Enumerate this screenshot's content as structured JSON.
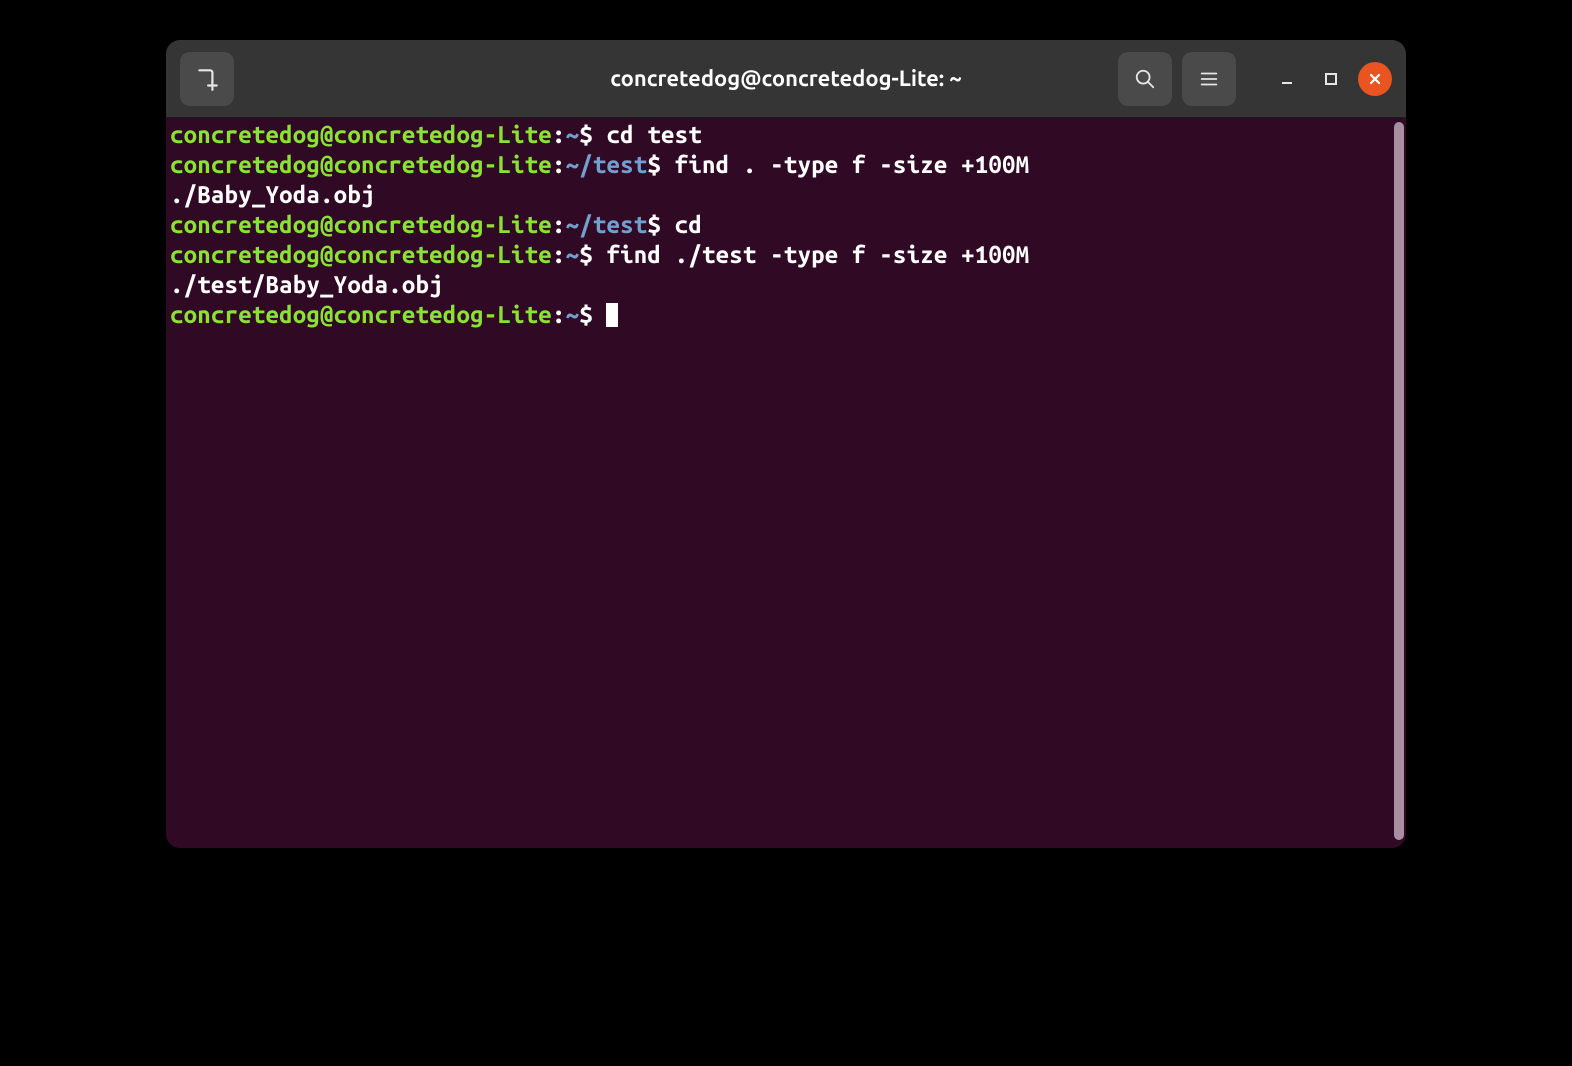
{
  "window": {
    "title": "concretedog@concretedog-Lite: ~"
  },
  "colors": {
    "bg": "#300a24",
    "user": "#8ae234",
    "path": "#729fcf",
    "text": "#ffffff",
    "close": "#e95420",
    "titlebar": "#353535"
  },
  "lines": [
    {
      "type": "prompt",
      "user": "concretedog@concretedog-Lite",
      "sep": ":",
      "path": "~",
      "dollar": "$",
      "cmd": " cd test"
    },
    {
      "type": "prompt",
      "user": "concretedog@concretedog-Lite",
      "sep": ":",
      "path": "~/test",
      "dollar": "$",
      "cmd": " find . -type f -size +100M"
    },
    {
      "type": "output",
      "text": "./Baby_Yoda.obj"
    },
    {
      "type": "prompt",
      "user": "concretedog@concretedog-Lite",
      "sep": ":",
      "path": "~/test",
      "dollar": "$",
      "cmd": " cd"
    },
    {
      "type": "prompt",
      "user": "concretedog@concretedog-Lite",
      "sep": ":",
      "path": "~",
      "dollar": "$",
      "cmd": " find ./test -type f -size +100M"
    },
    {
      "type": "output",
      "text": "./test/Baby_Yoda.obj"
    },
    {
      "type": "prompt",
      "user": "concretedog@concretedog-Lite",
      "sep": ":",
      "path": "~",
      "dollar": "$",
      "cmd": " ",
      "cursor": true
    }
  ]
}
